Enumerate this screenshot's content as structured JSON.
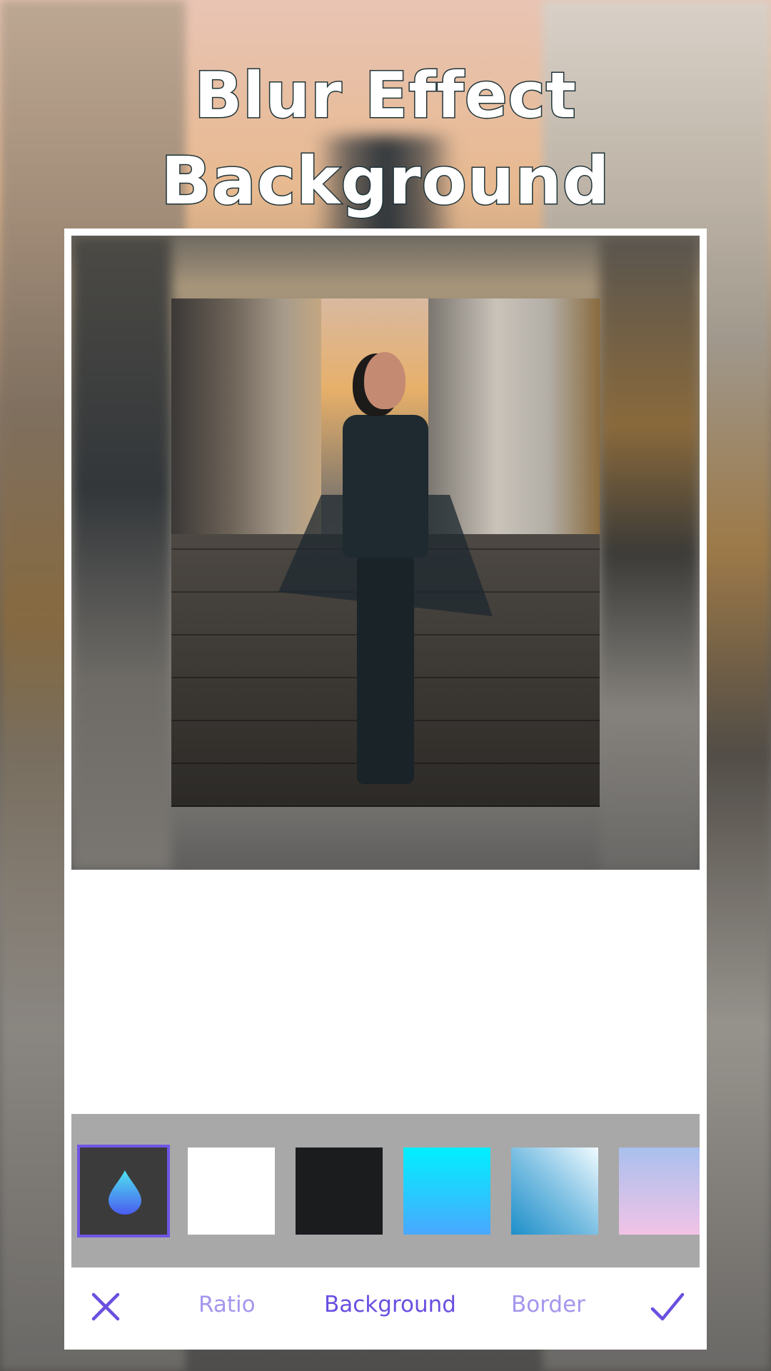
{
  "title": {
    "line1": "Blur Effect",
    "line2": "Background"
  },
  "editor": {
    "swatches": [
      {
        "name": "blur",
        "icon": "water-drop-icon",
        "selected": true,
        "fill": "#3b3b3b"
      },
      {
        "name": "white",
        "selected": false,
        "fill": "#ffffff"
      },
      {
        "name": "black",
        "selected": false,
        "fill": "#1b1c1e"
      },
      {
        "name": "cyan-blue-gradient",
        "selected": false,
        "gradient": [
          "#00f0ff",
          "#4aa8ff"
        ]
      },
      {
        "name": "blue-white-gradient",
        "selected": false,
        "gradient": [
          "#1e8fc9",
          "#e8f6fb"
        ]
      },
      {
        "name": "lavender-pink-gradient",
        "selected": false,
        "gradient": [
          "#a9c0ee",
          "#f1c3e6"
        ]
      }
    ],
    "accent_color": "#6a4fe0",
    "inactive_color": "#a596ee"
  },
  "toolbar": {
    "cancel_icon": "close-icon",
    "tabs": [
      {
        "label": "Ratio",
        "active": false
      },
      {
        "label": "Background",
        "active": true
      },
      {
        "label": "Border",
        "active": false
      }
    ],
    "confirm_icon": "check-icon"
  }
}
